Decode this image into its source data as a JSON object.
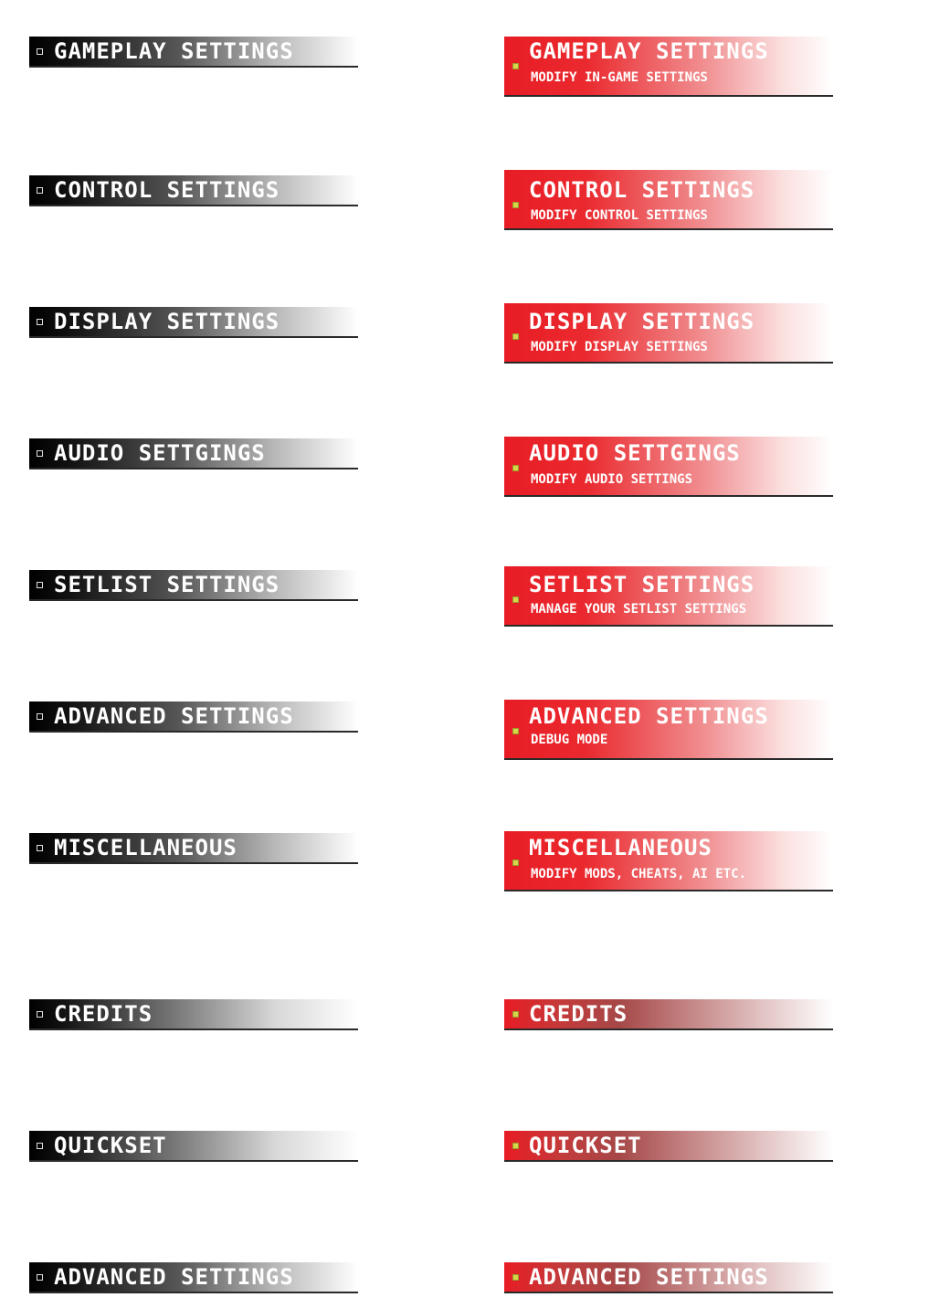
{
  "left_column": [
    {
      "title": "GAMEPLAY SETTINGS"
    },
    {
      "title": "CONTROL SETTINGS"
    },
    {
      "title": "DISPLAY SETTINGS"
    },
    {
      "title": "AUDIO SETTGINGS"
    },
    {
      "title": "SETLIST SETTINGS"
    },
    {
      "title": "ADVANCED SETTINGS"
    },
    {
      "title": "MISCELLANEOUS"
    },
    {
      "title": "CREDITS"
    },
    {
      "title": "QUICKSET"
    },
    {
      "title": "ADVANCED SETTINGS"
    }
  ],
  "right_column": [
    {
      "title": "GAMEPLAY SETTINGS",
      "subtitle": "MODIFY IN-GAME SETTINGS"
    },
    {
      "title": "CONTROL SETTINGS",
      "subtitle": "MODIFY CONTROL SETTINGS"
    },
    {
      "title": "DISPLAY SETTINGS",
      "subtitle": "MODIFY DISPLAY SETTINGS"
    },
    {
      "title": "AUDIO SETTGINGS",
      "subtitle": "MODIFY AUDIO SETTINGS"
    },
    {
      "title": "SETLIST SETTINGS",
      "subtitle": "MANAGE YOUR SETLIST SETTINGS"
    },
    {
      "title": "ADVANCED SETTINGS",
      "subtitle": "DEBUG MODE"
    },
    {
      "title": "MISCELLANEOUS",
      "subtitle": "MODIFY MODS, CHEATS, AI ETC."
    },
    {
      "title": "CREDITS"
    },
    {
      "title": "QUICKSET"
    },
    {
      "title": "ADVANCED SETTINGS"
    }
  ],
  "colors": {
    "selected_red": "#e81c24",
    "normal_black": "#000000",
    "bullet_yellow": "#d6d64a",
    "underline": "#2a2a2a"
  },
  "icons": {
    "normal_bullet": "hollow-square-bullet-icon",
    "selected_bullet": "yellow-square-bullet-icon"
  }
}
